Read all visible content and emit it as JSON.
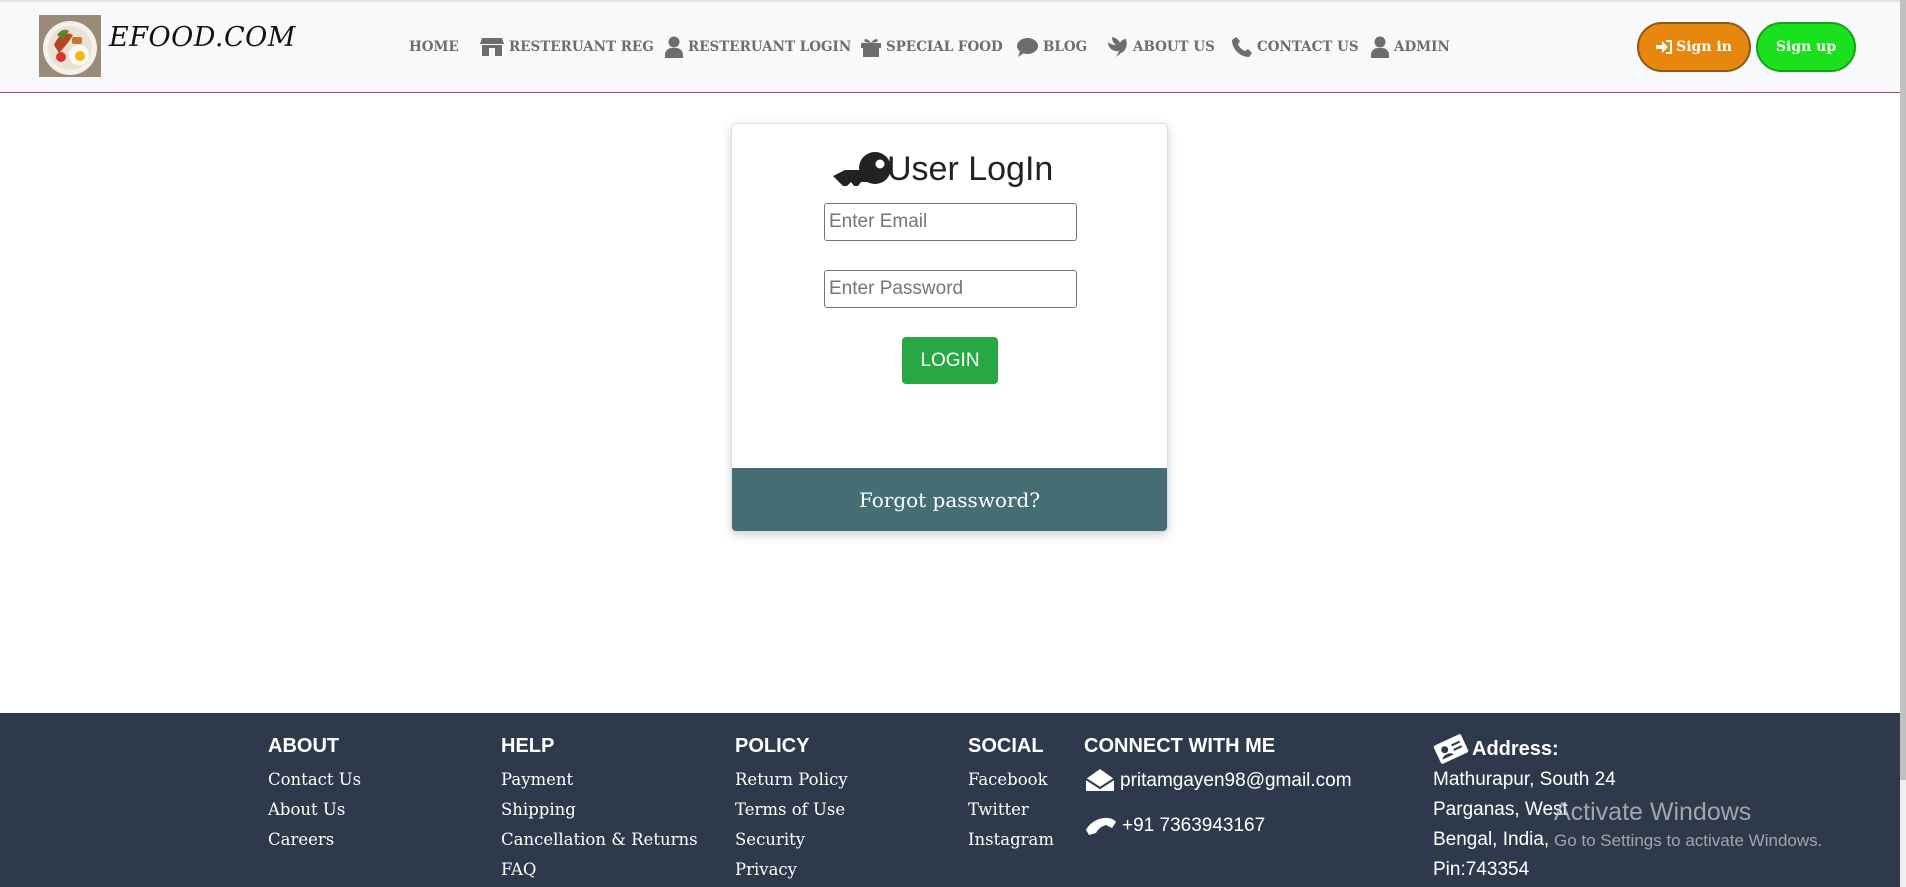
{
  "navbar": {
    "brand": "EFOOD.COM",
    "items": [
      {
        "label": "HOME"
      },
      {
        "label": "RESTERUANT REG"
      },
      {
        "label": "RESTERUANT LOGIN"
      },
      {
        "label": "SPECIAL FOOD"
      },
      {
        "label": "BLOG"
      },
      {
        "label": "ABOUT US"
      },
      {
        "label": "CONTACT US"
      },
      {
        "label": "ADMIN"
      }
    ],
    "signin_label": "Sign in",
    "signup_label": "Sign up"
  },
  "login": {
    "title": "User LogIn",
    "email_placeholder": "Enter Email",
    "password_placeholder": "Enter Password",
    "login_label": "LOGIN",
    "forgot_label": "Forgot password?"
  },
  "footer": {
    "about": {
      "heading": "ABOUT",
      "links": [
        "Contact Us",
        "About Us",
        "Careers"
      ]
    },
    "help": {
      "heading": "HELP",
      "links": [
        "Payment",
        "Shipping",
        "Cancellation & Returns",
        "FAQ"
      ]
    },
    "policy": {
      "heading": "POLICY",
      "links": [
        "Return Policy",
        "Terms of Use",
        "Security",
        "Privacy"
      ]
    },
    "social": {
      "heading": "SOCIAL",
      "links": [
        "Facebook",
        "Twitter",
        "Instagram"
      ]
    },
    "connect": {
      "heading": "CONNECT WITH ME",
      "email": "pritamgayen98@gmail.com",
      "phone": "+91 7363943167"
    },
    "address": {
      "heading": "Address:",
      "lines": [
        "Mathurapur, South 24",
        "Parganas, West",
        "Bengal, India,",
        "Pin:743354"
      ]
    }
  },
  "watermark": {
    "line1": "Activate Windows",
    "line2": "Go to Settings to activate Windows."
  },
  "colors": {
    "navbar_bg": "#f8f9fa",
    "signin": "#e8870e",
    "signup": "#19e11b",
    "login_btn": "#28a745",
    "forgot_bg": "#456e74",
    "footer_bg": "#2e3a4c"
  }
}
